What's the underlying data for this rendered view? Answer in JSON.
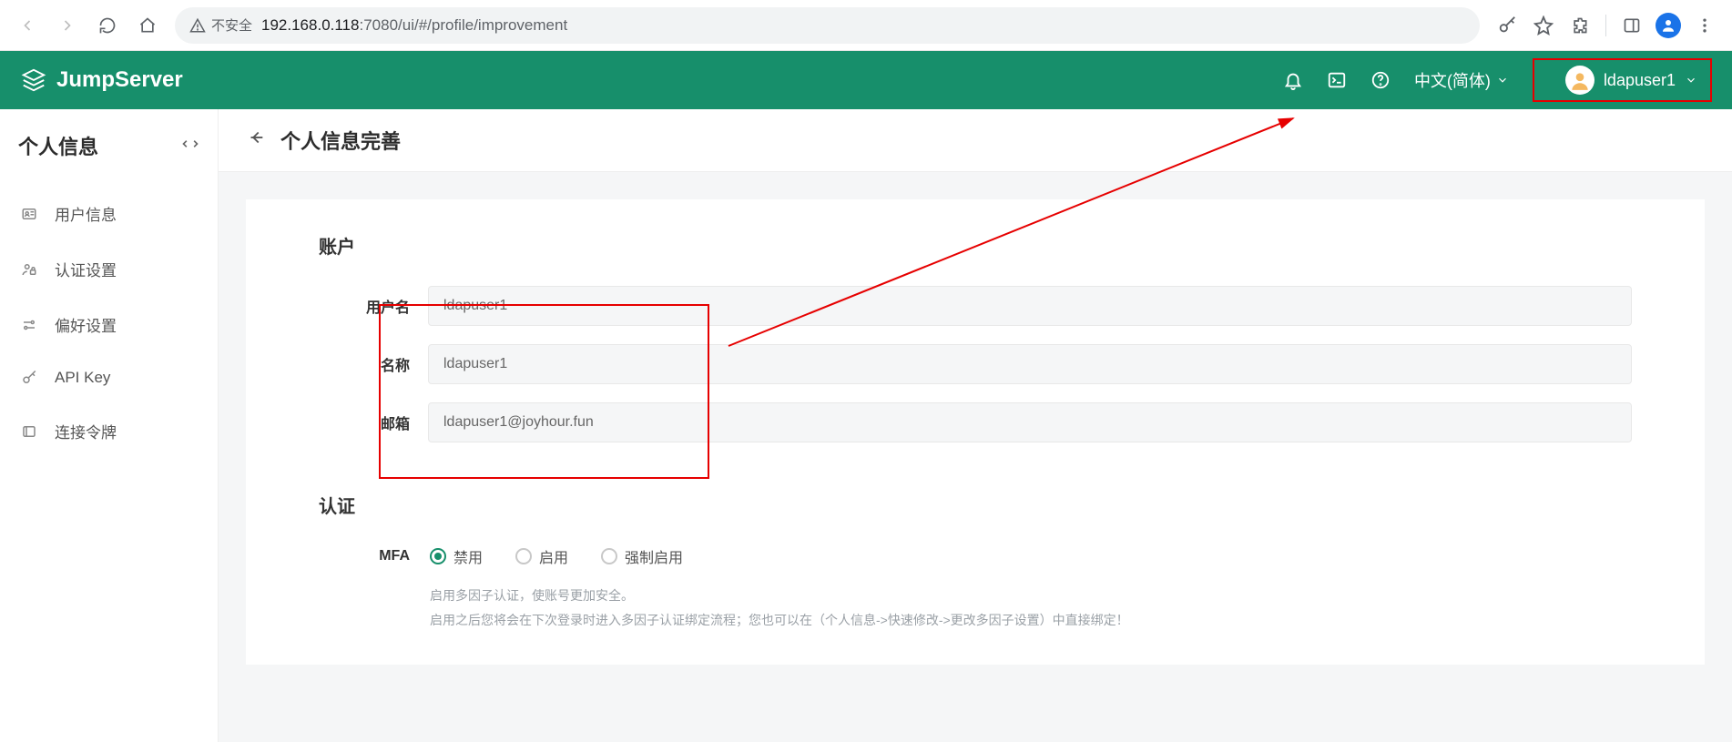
{
  "browser": {
    "insecure_label": "不安全",
    "url_host": "192.168.0.118",
    "url_port": ":7080",
    "url_path": "/ui/#/profile/improvement"
  },
  "header": {
    "brand": "JumpServer",
    "language": "中文(简体)",
    "username": "ldapuser1"
  },
  "sidebar": {
    "title": "个人信息",
    "items": [
      {
        "icon": "user-card",
        "label": "用户信息"
      },
      {
        "icon": "auth",
        "label": "认证设置"
      },
      {
        "icon": "pref",
        "label": "偏好设置"
      },
      {
        "icon": "key",
        "label": "API Key"
      },
      {
        "icon": "token",
        "label": "连接令牌"
      }
    ]
  },
  "page": {
    "title": "个人信息完善",
    "sections": {
      "account": {
        "title": "账户",
        "fields": {
          "username": {
            "label": "用户名",
            "value": "ldapuser1"
          },
          "name": {
            "label": "名称",
            "value": "ldapuser1"
          },
          "email": {
            "label": "邮箱",
            "value": "ldapuser1@joyhour.fun"
          }
        }
      },
      "auth": {
        "title": "认证",
        "mfa": {
          "label": "MFA",
          "options": [
            "禁用",
            "启用",
            "强制启用"
          ],
          "selected": 0,
          "hint1": "启用多因子认证，使账号更加安全。",
          "hint2": "启用之后您将会在下次登录时进入多因子认证绑定流程；您也可以在（个人信息->快速修改->更改多因子设置）中直接绑定！"
        }
      }
    }
  }
}
